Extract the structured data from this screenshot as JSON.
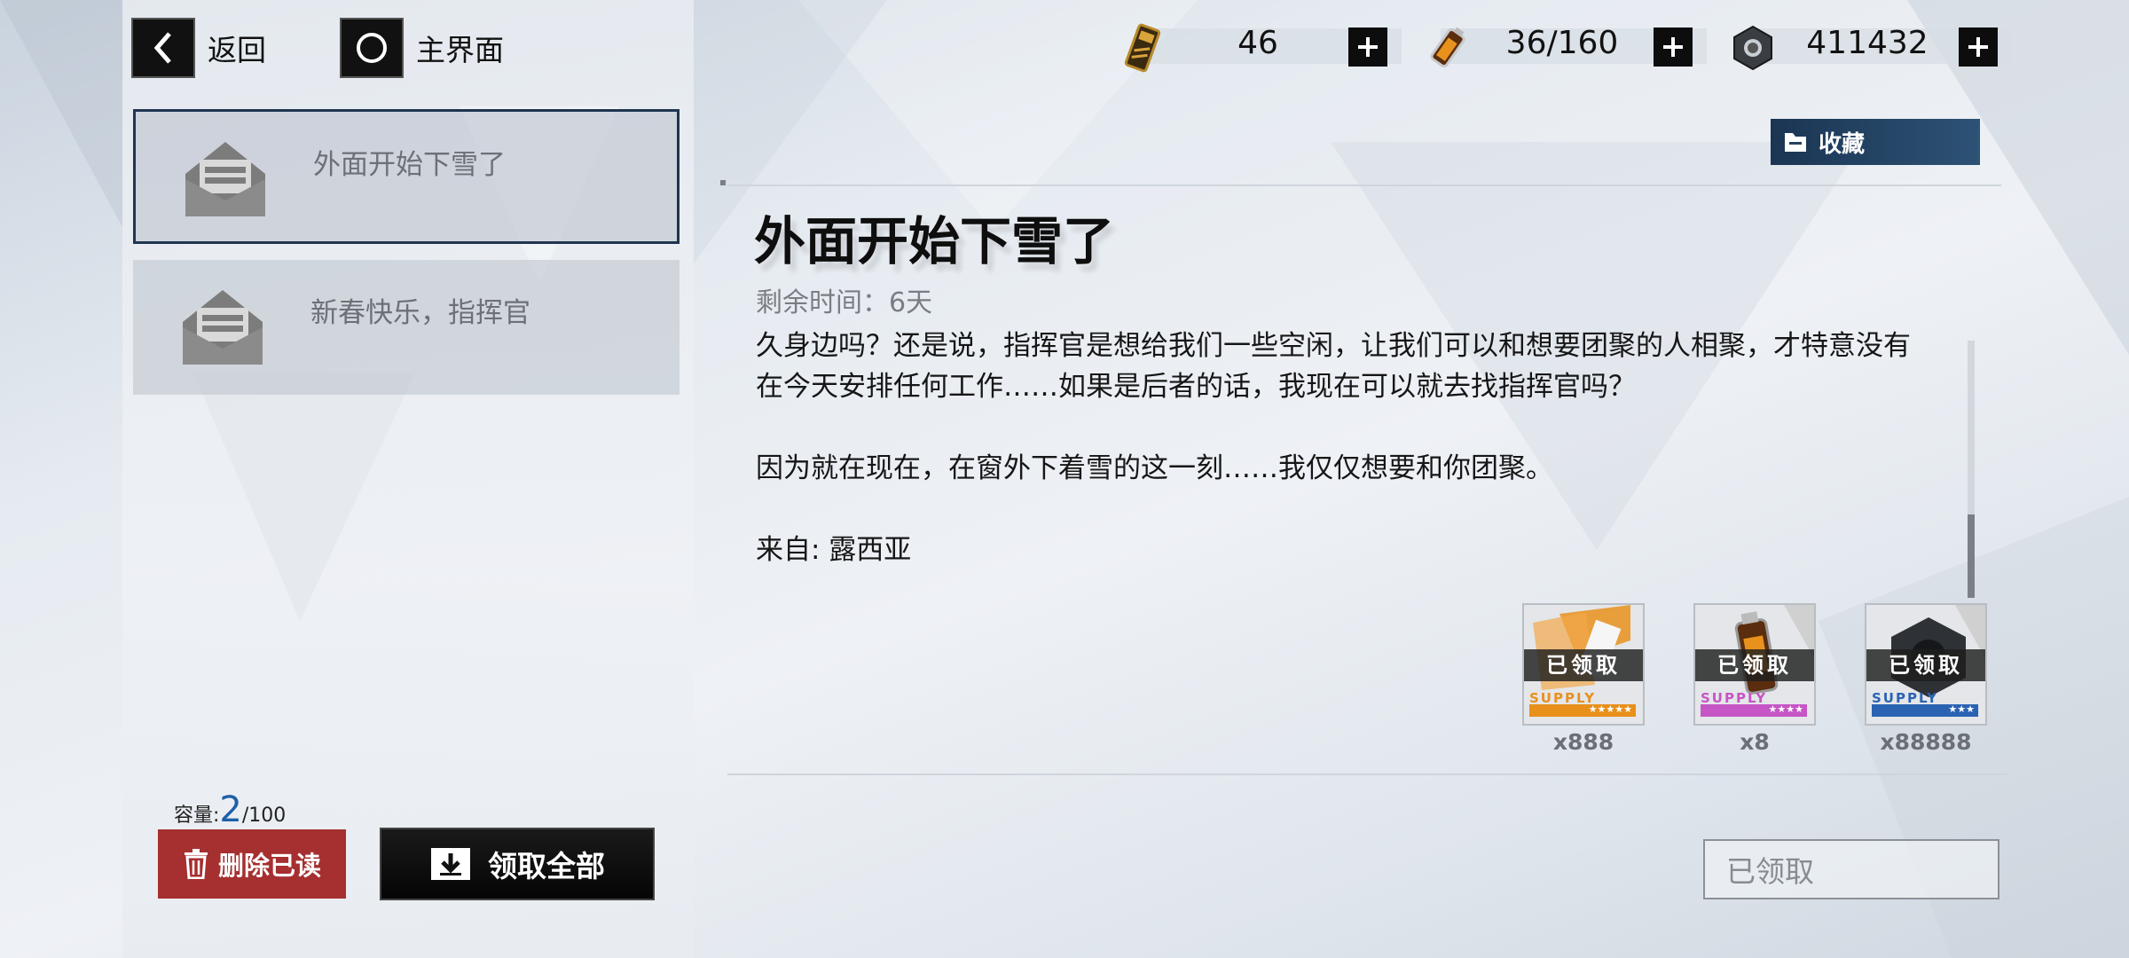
{
  "nav": {
    "back_label": "返回",
    "home_label": "主界面"
  },
  "resources": [
    {
      "icon": "gold-card-icon",
      "value": "46"
    },
    {
      "icon": "battery-icon",
      "value": "36/160"
    },
    {
      "icon": "hex-nut-icon",
      "value": "411432"
    }
  ],
  "mail_list": [
    {
      "title": "外面开始下雪了",
      "selected": true
    },
    {
      "title": "新春快乐，指挥官",
      "selected": false
    }
  ],
  "capacity": {
    "label": "容量:",
    "current": "2",
    "max": "/100"
  },
  "buttons": {
    "delete_read": "删除已读",
    "claim_all": "领取全部",
    "favorite": "收藏",
    "claimed": "已领取"
  },
  "mail": {
    "title": "外面开始下雪了",
    "remaining": "剩余时间：6天",
    "body_lines": [
      "久身边吗？还是说，指挥官是想给我们一些空闲，让我们可以和想要团聚的人相聚，才特意没有",
      "在今天安排任何工作……如果是后者的话，我现在可以就去找指挥官吗？",
      "",
      "因为就在现在，在窗外下着雪的这一刻……我仅仅想要和你团聚。",
      "",
      "来自: 露西亚"
    ]
  },
  "rewards": [
    {
      "claimed_label": "已领取",
      "supply": "SUPPLY",
      "count": "x888",
      "color": "#e8901c",
      "stars": "★★★★★"
    },
    {
      "claimed_label": "已领取",
      "supply": "SUPPLY",
      "count": "x8",
      "color": "#c655c6",
      "stars": "★★★★"
    },
    {
      "claimed_label": "已领取",
      "supply": "SUPPLY",
      "count": "x88888",
      "color": "#2b63b3",
      "stars": "★★★"
    }
  ]
}
